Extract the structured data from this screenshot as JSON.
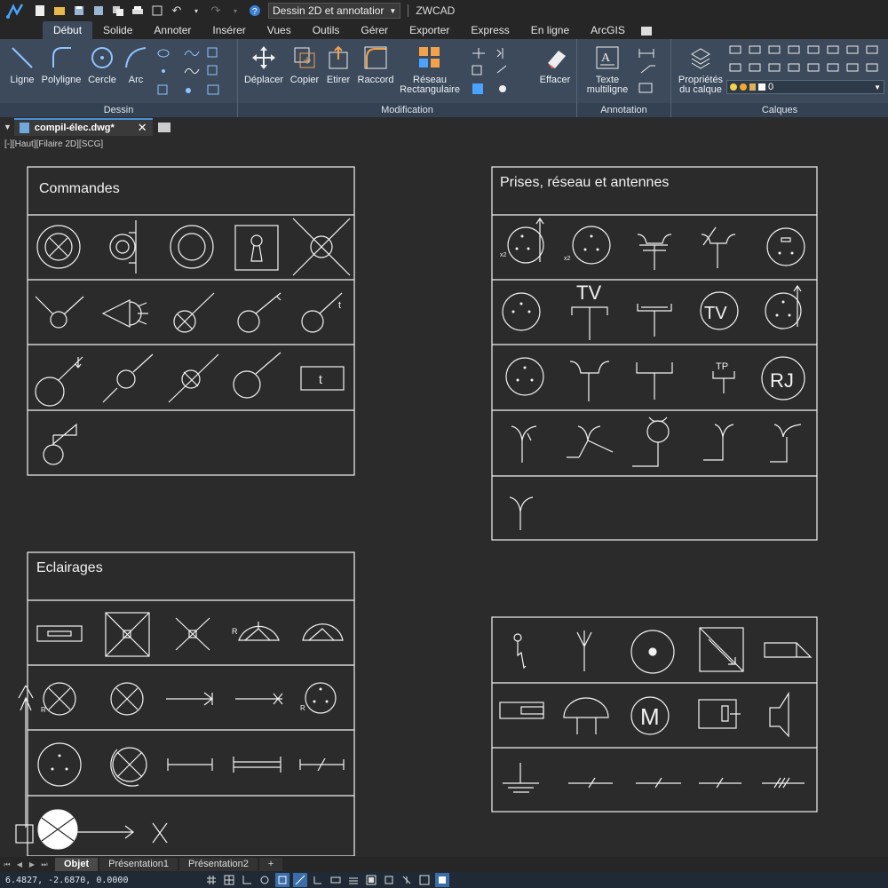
{
  "app": {
    "title": "ZWCAD",
    "workspace": "Dessin 2D et annotatior"
  },
  "ribbon": {
    "tabs": [
      "Début",
      "Solide",
      "Annoter",
      "Insérer",
      "Vues",
      "Outils",
      "Gérer",
      "Exporter",
      "Express",
      "En ligne",
      "ArcGIS"
    ],
    "active_tab": "Début",
    "groups": {
      "dessin": {
        "label": "Dessin",
        "buttons": [
          "Ligne",
          "Polyligne",
          "Cercle",
          "Arc"
        ]
      },
      "modification": {
        "label": "Modification",
        "buttons": [
          "Déplacer",
          "Copier",
          "Etirer",
          "Raccord"
        ],
        "reseau_line1": "Réseau",
        "reseau_line2": "Rectangulaire",
        "effacer": "Effacer"
      },
      "annotation": {
        "label": "Annotation",
        "texte_line1": "Texte",
        "texte_line2": "multiligne"
      },
      "calques": {
        "label": "Calques",
        "prop_line1": "Propriétés",
        "prop_line2": "du calque",
        "current_layer": "0"
      }
    }
  },
  "document": {
    "tab": "compil-élec.dwg*",
    "viewport_label": "[-][Haut][Filaire 2D][SCG]"
  },
  "drawing": {
    "panels": {
      "commandes": "Commandes",
      "prises": "Prises, réseau et antennes",
      "eclairages": "Eclairages"
    },
    "symbol_text": {
      "t": "t",
      "tv": "TV",
      "tp": "TP",
      "rj": "RJ",
      "m": "M",
      "r": "R",
      "x2": "x2"
    }
  },
  "layout_tabs": [
    "Objet",
    "Présentation1",
    "Présentation2",
    "+"
  ],
  "status": {
    "coords": "6.4827, -2.6870, 0.0000"
  },
  "colors": {
    "ribbon_bg": "#3c4a5c",
    "canvas_bg": "#2b2b2b",
    "accent": "#4a90d9"
  }
}
